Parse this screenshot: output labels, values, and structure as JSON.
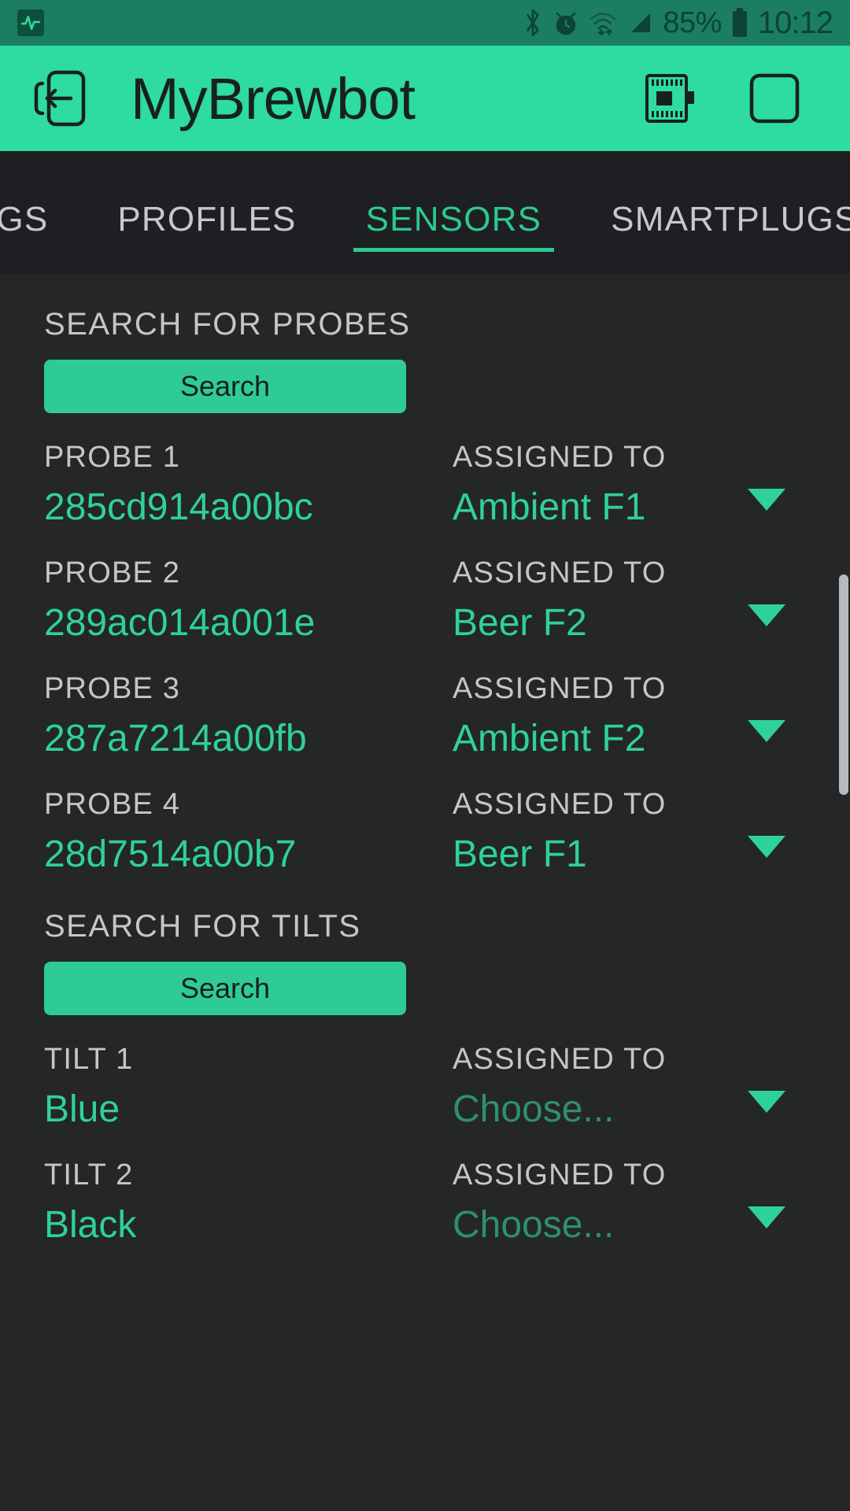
{
  "status_bar": {
    "app_icon": "activity-monitor-icon",
    "icons": [
      "bluetooth-icon",
      "alarm-icon",
      "wifi-icon",
      "signal-icon"
    ],
    "battery_percent": "85%",
    "battery_icon": "battery-icon",
    "clock": "10:12"
  },
  "app_bar": {
    "back_icon": "back-exit-icon",
    "title": "MyBrewbot",
    "device_icon": "chip-device-icon",
    "square_icon": "square-outline-icon"
  },
  "tabs": [
    {
      "label": "INGS",
      "active": false
    },
    {
      "label": "PROFILES",
      "active": false
    },
    {
      "label": "SENSORS",
      "active": true
    },
    {
      "label": "SMARTPLUGS",
      "active": false
    }
  ],
  "probes_section": {
    "heading": "SEARCH FOR PROBES",
    "search_label": "Search",
    "assigned_label": "ASSIGNED TO",
    "rows": [
      {
        "label": "PROBE 1",
        "value": "285cd914a00bc",
        "assigned": "Ambient F1",
        "is_placeholder": false
      },
      {
        "label": "PROBE 2",
        "value": "289ac014a001e",
        "assigned": "Beer F2",
        "is_placeholder": false
      },
      {
        "label": "PROBE 3",
        "value": "287a7214a00fb",
        "assigned": "Ambient F2",
        "is_placeholder": false
      },
      {
        "label": "PROBE 4",
        "value": "28d7514a00b7",
        "assigned": "Beer F1",
        "is_placeholder": false
      }
    ]
  },
  "tilts_section": {
    "heading": "SEARCH FOR TILTS",
    "search_label": "Search",
    "assigned_label": "ASSIGNED TO",
    "rows": [
      {
        "label": "TILT 1",
        "value": "Blue",
        "assigned": "Choose...",
        "is_placeholder": true
      },
      {
        "label": "TILT 2",
        "value": "Black",
        "assigned": "Choose...",
        "is_placeholder": true
      }
    ]
  },
  "colors": {
    "accent": "#2ed9a0",
    "status_bar_bg": "#1b7d61",
    "content_bg": "#242628",
    "tab_bar_bg": "#1d1f22",
    "label_text": "#c4c6c8",
    "value_text": "#2fd19a",
    "placeholder_text": "#2f8f6c"
  }
}
